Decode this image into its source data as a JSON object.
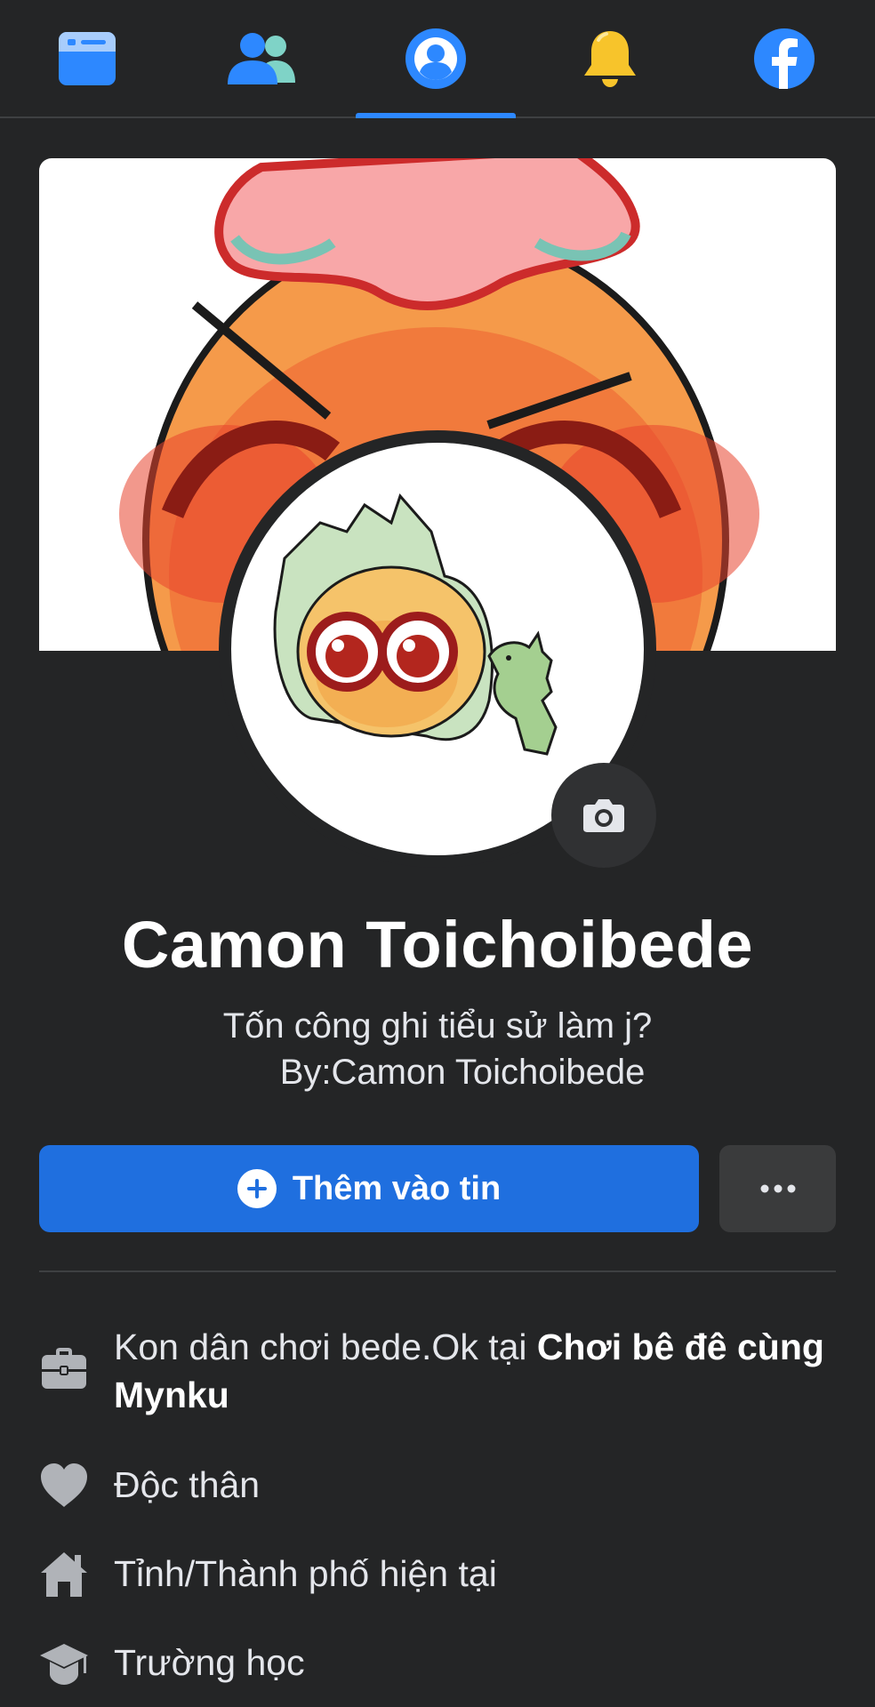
{
  "nav": {
    "tabs": [
      {
        "name": "feed",
        "icon": "feed-icon",
        "active": false
      },
      {
        "name": "friends",
        "icon": "friends-icon",
        "active": false
      },
      {
        "name": "profile",
        "icon": "profile-icon",
        "active": true
      },
      {
        "name": "notifications",
        "icon": "bell-icon",
        "active": false
      },
      {
        "name": "menu",
        "icon": "facebook-logo-icon",
        "active": false
      }
    ]
  },
  "profile": {
    "name": "Camon Toichoibede",
    "bio_line1": "Tốn công ghi tiểu sử làm j?",
    "bio_line2": "By:Camon Toichoibede"
  },
  "actions": {
    "add_story_label": "Thêm vào tin",
    "more_label": "More options"
  },
  "intro": {
    "work_prefix": "Kon dân chơi bede.Ok tại ",
    "work_place": "Chơi bê đê cùng Mynku",
    "relationship": "Độc thân",
    "current_city": "Tỉnh/Thành phố hiện tại",
    "education": "Trường học"
  },
  "colors": {
    "background": "#242526",
    "accent": "#2d88ff",
    "primary_button": "#1f6fdf",
    "secondary_button": "#3a3b3c"
  }
}
